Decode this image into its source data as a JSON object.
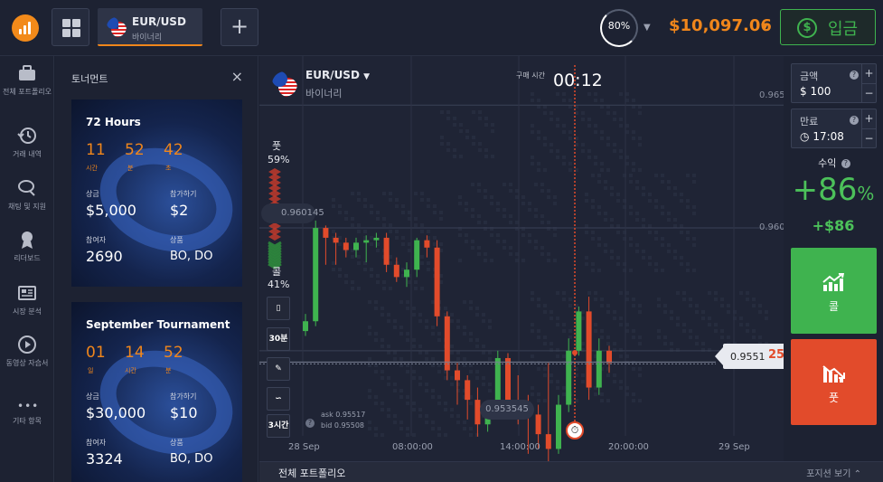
{
  "topbar": {
    "asset_tab": {
      "name": "EUR/USD",
      "type": "바이너리"
    },
    "add_button": "+",
    "payout_ring": "80%",
    "balance": "$10,097.06",
    "deposit_label": "입금",
    "deposit_icon_glyph": "$"
  },
  "sidebar": {
    "items": [
      {
        "label": "전체 포트폴리오",
        "icon": "briefcase-icon"
      },
      {
        "label": "거래 내역",
        "icon": "history-icon"
      },
      {
        "label": "채팅 및 지원",
        "icon": "chat-icon"
      },
      {
        "label": "리더보드",
        "icon": "medal-icon"
      },
      {
        "label": "시장 분석",
        "icon": "newspaper-icon"
      },
      {
        "label": "동영상 자습서",
        "icon": "play-icon"
      },
      {
        "label": "기타 항목",
        "icon": "more-icon"
      }
    ],
    "more_glyph": "•••"
  },
  "tournaments": {
    "title": "토너먼트",
    "close_glyph": "×",
    "cards": [
      {
        "name": "72 Hours",
        "time": [
          {
            "value": "11",
            "unit": "시간"
          },
          {
            "value": "52",
            "unit": "분"
          },
          {
            "value": "42",
            "unit": "초"
          }
        ],
        "prize_label": "상금",
        "prize": "$5,000",
        "fee_label": "참가하기",
        "fee": "$2",
        "players_label": "참여자",
        "players": "2690",
        "assets_label": "상품",
        "assets": "BO, DO"
      },
      {
        "name": "September Tournament",
        "time": [
          {
            "value": "01",
            "unit": "일"
          },
          {
            "value": "14",
            "unit": "시간"
          },
          {
            "value": "52",
            "unit": "분"
          }
        ],
        "prize_label": "상금",
        "prize": "$30,000",
        "fee_label": "참가하기",
        "fee": "$10",
        "players_label": "참여자",
        "players": "3324",
        "assets_label": "상품",
        "assets": "BO, DO"
      }
    ]
  },
  "chart_header": {
    "asset": "EUR/USD",
    "asset_type": "바이너리",
    "buy_time_label": "구매 시간",
    "buy_time": "00:12"
  },
  "sentiment": {
    "put_label": "풋",
    "put_pct": "59%",
    "call_label": "콜",
    "call_pct": "41%"
  },
  "tools": {
    "candles_glyph": "▯",
    "timeframe": "30분",
    "draw_glyph": "✎",
    "indicator_glyph": "∽",
    "period": "3시간"
  },
  "quotes": {
    "ask": "ask 0.95517",
    "bid": "bid 0.95508",
    "help_glyph": "?",
    "current_main": "0.9551",
    "current_tail": "25",
    "high_label": "0.960145",
    "low_label": "0.953545",
    "timer_glyph": "⏱"
  },
  "chart_data": {
    "type": "candlestick",
    "x_ticks": [
      "28 Sep",
      "08:00:00",
      "14:00:00",
      "20:00:00",
      "29 Sep"
    ],
    "y_ticks": [
      "0.965",
      "0.960",
      "0.955"
    ],
    "ylim": [
      0.9505,
      0.967
    ],
    "up_color": "#3fb34f",
    "down_color": "#e24b2b",
    "candles": [
      {
        "o": 0.9558,
        "h": 0.9565,
        "l": 0.9556,
        "c": 0.9562
      },
      {
        "o": 0.9562,
        "h": 0.9603,
        "l": 0.956,
        "c": 0.96
      },
      {
        "o": 0.96,
        "h": 0.9601,
        "l": 0.9585,
        "c": 0.9596
      },
      {
        "o": 0.9596,
        "h": 0.9598,
        "l": 0.9585,
        "c": 0.9594
      },
      {
        "o": 0.9594,
        "h": 0.9596,
        "l": 0.9588,
        "c": 0.9591
      },
      {
        "o": 0.9591,
        "h": 0.9596,
        "l": 0.9588,
        "c": 0.9594
      },
      {
        "o": 0.9594,
        "h": 0.9597,
        "l": 0.9586,
        "c": 0.9595
      },
      {
        "o": 0.9595,
        "h": 0.9598,
        "l": 0.9592,
        "c": 0.9596
      },
      {
        "o": 0.9596,
        "h": 0.9598,
        "l": 0.9582,
        "c": 0.9585
      },
      {
        "o": 0.9585,
        "h": 0.9588,
        "l": 0.9578,
        "c": 0.958
      },
      {
        "o": 0.958,
        "h": 0.9586,
        "l": 0.9576,
        "c": 0.9583
      },
      {
        "o": 0.9583,
        "h": 0.9596,
        "l": 0.958,
        "c": 0.9595
      },
      {
        "o": 0.9595,
        "h": 0.9597,
        "l": 0.9588,
        "c": 0.9592
      },
      {
        "o": 0.9592,
        "h": 0.9595,
        "l": 0.956,
        "c": 0.9564
      },
      {
        "o": 0.9564,
        "h": 0.9566,
        "l": 0.9538,
        "c": 0.9542
      },
      {
        "o": 0.9542,
        "h": 0.9545,
        "l": 0.9528,
        "c": 0.9538
      },
      {
        "o": 0.9538,
        "h": 0.954,
        "l": 0.9522,
        "c": 0.953
      },
      {
        "o": 0.953,
        "h": 0.9535,
        "l": 0.9515,
        "c": 0.952
      },
      {
        "o": 0.952,
        "h": 0.9528,
        "l": 0.9517,
        "c": 0.9525
      },
      {
        "o": 0.9525,
        "h": 0.955,
        "l": 0.9522,
        "c": 0.9547
      },
      {
        "o": 0.9547,
        "h": 0.9549,
        "l": 0.9525,
        "c": 0.953
      },
      {
        "o": 0.953,
        "h": 0.954,
        "l": 0.952,
        "c": 0.9527
      },
      {
        "o": 0.9527,
        "h": 0.9532,
        "l": 0.9508,
        "c": 0.9524
      },
      {
        "o": 0.9524,
        "h": 0.9528,
        "l": 0.951,
        "c": 0.9516
      },
      {
        "o": 0.9516,
        "h": 0.9545,
        "l": 0.9505,
        "c": 0.951
      },
      {
        "o": 0.951,
        "h": 0.9532,
        "l": 0.9508,
        "c": 0.9528
      },
      {
        "o": 0.9528,
        "h": 0.9555,
        "l": 0.9525,
        "c": 0.955
      },
      {
        "o": 0.955,
        "h": 0.9568,
        "l": 0.9548,
        "c": 0.9566
      },
      {
        "o": 0.9566,
        "h": 0.9572,
        "l": 0.953,
        "c": 0.9535
      },
      {
        "o": 0.9535,
        "h": 0.9555,
        "l": 0.9532,
        "c": 0.955
      },
      {
        "o": 0.955,
        "h": 0.9552,
        "l": 0.9541,
        "c": 0.9545
      }
    ]
  },
  "bottombar": {
    "title": "전체 포트폴리오",
    "right": "포지션 보기"
  },
  "trade_panel": {
    "amount_label": "금액",
    "amount_currency": "$",
    "amount": "100",
    "expiry_label": "만료",
    "expiry_icon": "◷",
    "expiry": "17:08",
    "help_glyph": "?",
    "plus_glyph": "+",
    "minus_glyph": "−",
    "profit_label": "수익",
    "profit_pct": "+86",
    "profit_pct_sign": "%",
    "profit_amount": "+$86",
    "call_label": "콜",
    "put_label": "풋"
  }
}
